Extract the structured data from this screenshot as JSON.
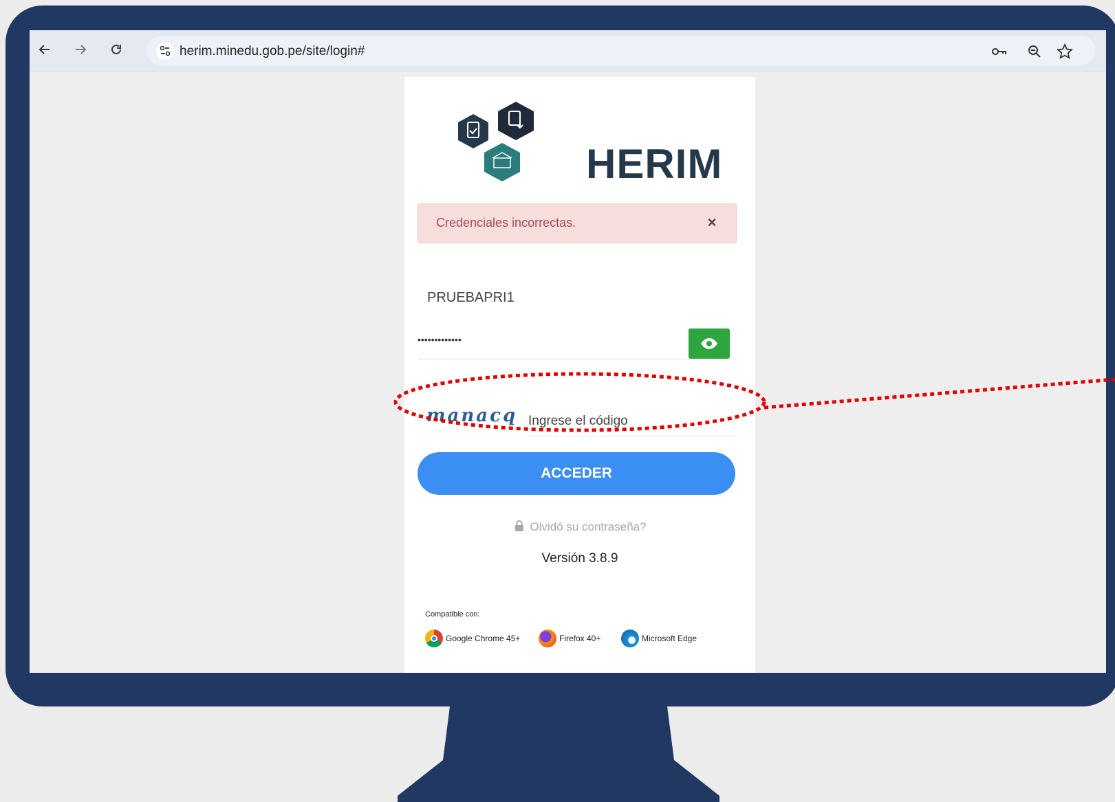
{
  "browser": {
    "url": "herim.minedu.gob.pe/site/login#",
    "back_icon": "arrow-left-icon",
    "forward_icon": "arrow-right-icon",
    "reload_icon": "reload-icon",
    "site_info_icon": "tune-icon",
    "key_icon": "key-icon",
    "zoom_icon": "zoom-icon",
    "star_icon": "star-icon"
  },
  "login": {
    "brand": "HERIM",
    "alert": {
      "message": "Credenciales incorrectas.",
      "close": "×"
    },
    "username": "PRUEBAPRI1",
    "password_mask": "•••••••••••••",
    "captcha_code": "manacq",
    "captcha_placeholder": "Ingrese el código",
    "submit_label": "ACCEDER",
    "forgot_label": "Olvidó su contraseña?",
    "version": "Versión 3.8.9",
    "compat_label": "Compatible con:",
    "browsers": [
      {
        "label": "Google Chrome 45+",
        "icon": "chrome-icon"
      },
      {
        "label": "Firefox 40+",
        "icon": "firefox-icon"
      },
      {
        "label": "Microsoft Edge",
        "icon": "edge-icon"
      }
    ]
  },
  "colors": {
    "monitor": "#213863",
    "submit": "#3b8ef2",
    "eye_button": "#2ea640",
    "alert_bg": "#f8dddd",
    "annotation": "#e10000"
  }
}
